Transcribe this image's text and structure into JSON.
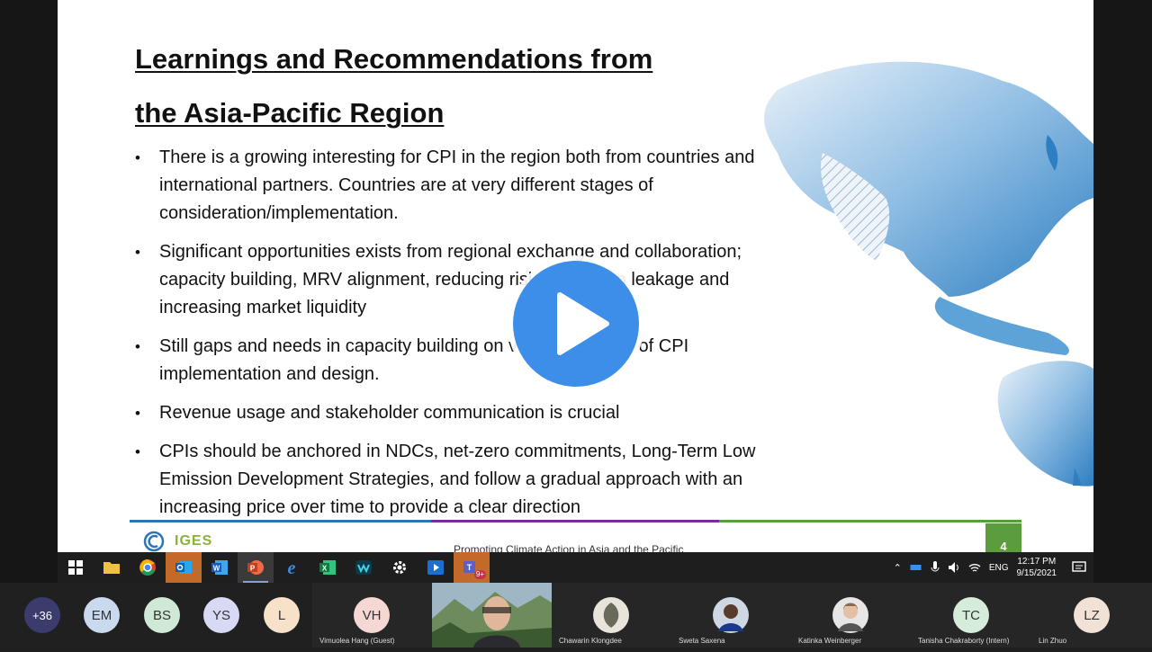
{
  "slide": {
    "title_line1": "Learnings and Recommendations from",
    "title_line2": "the Asia-Pacific Region",
    "bullets": [
      "There is a growing interesting for CPI in the region both from countries and international partners. Countries are at very different stages of consideration/implementation.",
      "Significant opportunities exists from regional exchange and collaboration; capacity building, MRV alignment, reducing risks of carbon leakage and increasing market liquidity",
      "Still gaps and needs in capacity building on various aspects of CPI implementation and design.",
      "Revenue usage and stakeholder communication is crucial",
      "CPIs should be anchored in NDCs, net-zero commitments, Long-Term Low Emission Development Strategies, and follow a gradual approach with an increasing price over time to provide a clear direction"
    ],
    "bullet_glyph": "•",
    "logo_text": "IGES",
    "footer_text": "Promoting Climate Action in Asia and the Pacific",
    "page_number": "4",
    "footer_colors": [
      "#2e75b6",
      "#7030a0",
      "#5b9c3e"
    ]
  },
  "player": {
    "icon": "play-icon"
  },
  "taskbar": {
    "apps": [
      {
        "name": "start-button",
        "icon": "windows-icon"
      },
      {
        "name": "file-explorer",
        "icon": "folder-icon"
      },
      {
        "name": "chrome",
        "icon": "chrome-icon"
      },
      {
        "name": "outlook",
        "icon": "outlook-icon"
      },
      {
        "name": "word",
        "icon": "word-icon"
      },
      {
        "name": "powerpoint",
        "icon": "powerpoint-icon"
      },
      {
        "name": "edge",
        "icon": "edge-icon"
      },
      {
        "name": "excel",
        "icon": "excel-icon"
      },
      {
        "name": "webex",
        "icon": "webex-icon"
      },
      {
        "name": "settings",
        "icon": "gear-icon"
      },
      {
        "name": "media-player",
        "icon": "media-icon"
      },
      {
        "name": "teams",
        "icon": "teams-icon",
        "badge": "9+"
      }
    ],
    "tray": {
      "language": "ENG",
      "time": "12:17 PM",
      "date": "9/15/2021"
    }
  },
  "participants": {
    "overflow": "+36",
    "avatars": [
      {
        "initials": "EM",
        "color": "#c9d9ee"
      },
      {
        "initials": "BS",
        "color": "#cfe9d6"
      },
      {
        "initials": "YS",
        "color": "#d8d9f5"
      },
      {
        "initials": "L",
        "color": "#f7e1c8"
      }
    ],
    "tiles": [
      {
        "initials": "VH",
        "name": "Vimuolea Hang (Guest)",
        "color": "#f5d8d4"
      },
      {
        "name": "Chawarin Klongdee"
      },
      {
        "name": "Sweta Saxena"
      },
      {
        "name": "Katinka Weinberger"
      },
      {
        "initials": "TC",
        "name": "Tanisha Chakraborty (Intern)",
        "color": "#d4ecd9"
      },
      {
        "initials": "LZ",
        "name": "Lin Zhuo",
        "color": "#f2e2d6"
      }
    ]
  }
}
